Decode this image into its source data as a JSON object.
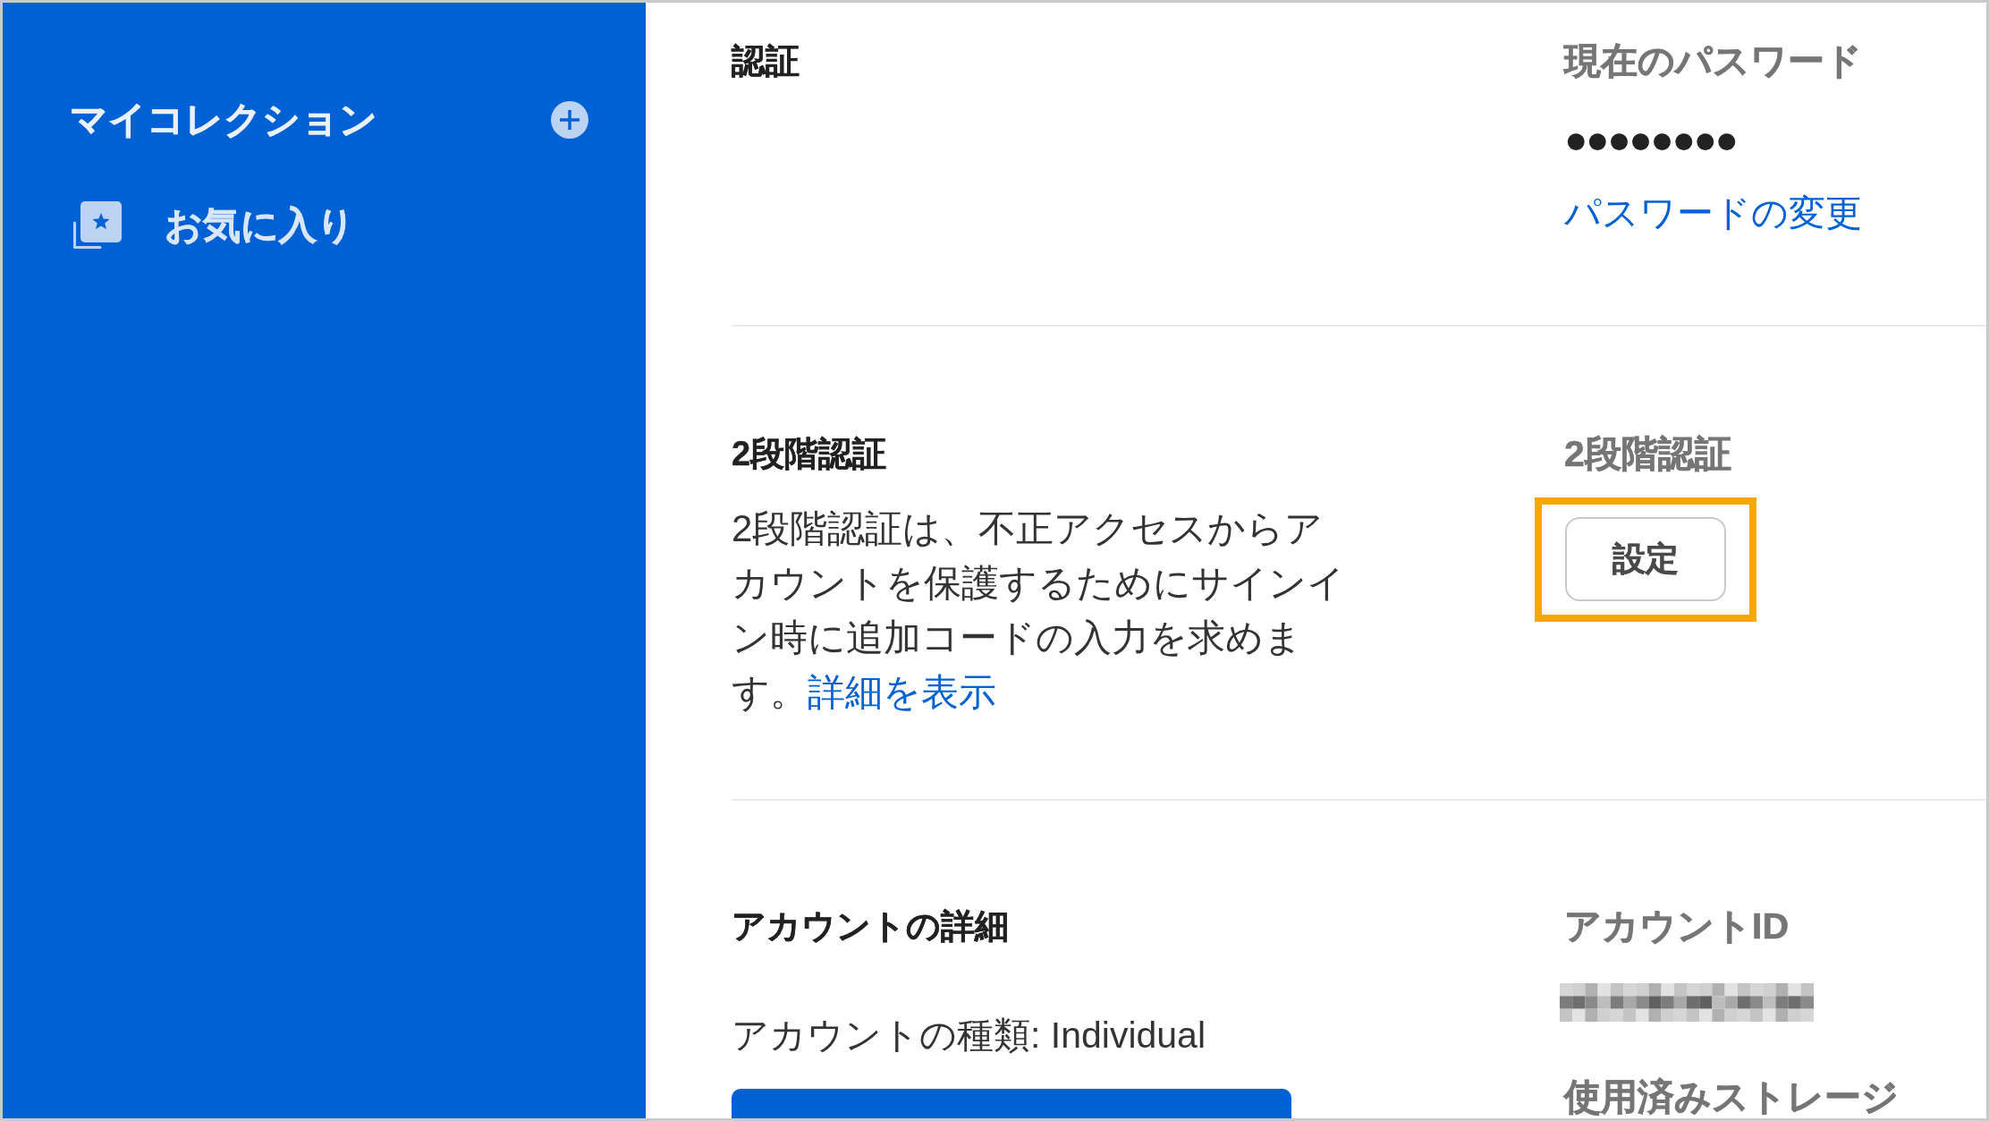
{
  "sidebar": {
    "title": "マイコレクション",
    "items": [
      {
        "label": "お気に入り"
      }
    ]
  },
  "sections": [
    {
      "title": "認証",
      "right": [
        {
          "kind": "label",
          "text": "現在のパスワード"
        },
        {
          "kind": "password",
          "text": "●●●●●●●●"
        },
        {
          "kind": "link",
          "text": "パスワードの変更"
        }
      ]
    },
    {
      "title": "2段階認証",
      "left": [
        {
          "kind": "paragraph",
          "text": "2段階認証は、不正アクセスからアカウントを保護するためにサインイン時に追加コードの入力を求めます。",
          "link": "詳細を表示"
        }
      ],
      "right": [
        {
          "kind": "label",
          "text": "2段階認証"
        },
        {
          "kind": "button",
          "text": "設定",
          "highlighted": true
        }
      ]
    },
    {
      "title": "アカウントの詳細",
      "left": [
        {
          "kind": "text",
          "text": "アカウントの種類: Individual"
        },
        {
          "kind": "primary_button"
        }
      ],
      "right": [
        {
          "kind": "label",
          "text": "アカウントID"
        },
        {
          "kind": "redacted"
        },
        {
          "kind": "label",
          "text": "使用済みストレージ"
        }
      ]
    }
  ]
}
